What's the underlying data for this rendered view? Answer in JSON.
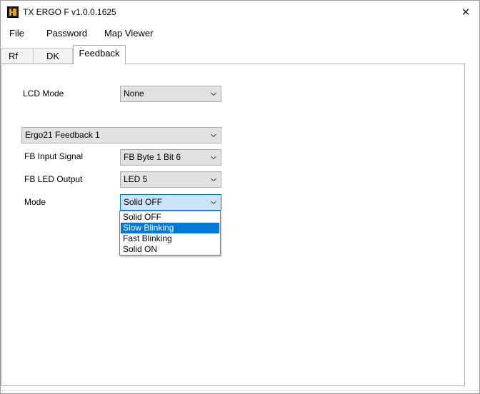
{
  "window": {
    "title": "TX ERGO F v1.0.0.1625",
    "close_glyph": "✕",
    "app_icon": "app-logo-icon"
  },
  "menu": [
    "File",
    "Password",
    "Map Viewer"
  ],
  "tabs": [
    {
      "label": "Rf",
      "active": false
    },
    {
      "label": "DK",
      "active": false
    },
    {
      "label": "Feedback",
      "active": true
    }
  ],
  "feedback": {
    "lcd_mode": {
      "label": "LCD Mode",
      "value": "None"
    },
    "feedback_channel": {
      "value": "Ergo21 Feedback 1"
    },
    "fb_input_signal": {
      "label": "FB Input Signal",
      "value": "FB Byte 1 Bit 6"
    },
    "fb_led_output": {
      "label": "FB LED Output",
      "value": "LED 5"
    },
    "mode": {
      "label": "Mode",
      "value": "Solid OFF",
      "expanded": true,
      "options": [
        "Solid OFF",
        "Slow Blinking",
        "Fast Blinking",
        "Solid ON"
      ],
      "highlighted": "Slow Blinking"
    }
  },
  "colors": {
    "accent": "#0078d7",
    "combo_bg": "#e1e1e1",
    "combo_open_bg": "#cce4f7",
    "icon_orange": "#e8a318"
  }
}
